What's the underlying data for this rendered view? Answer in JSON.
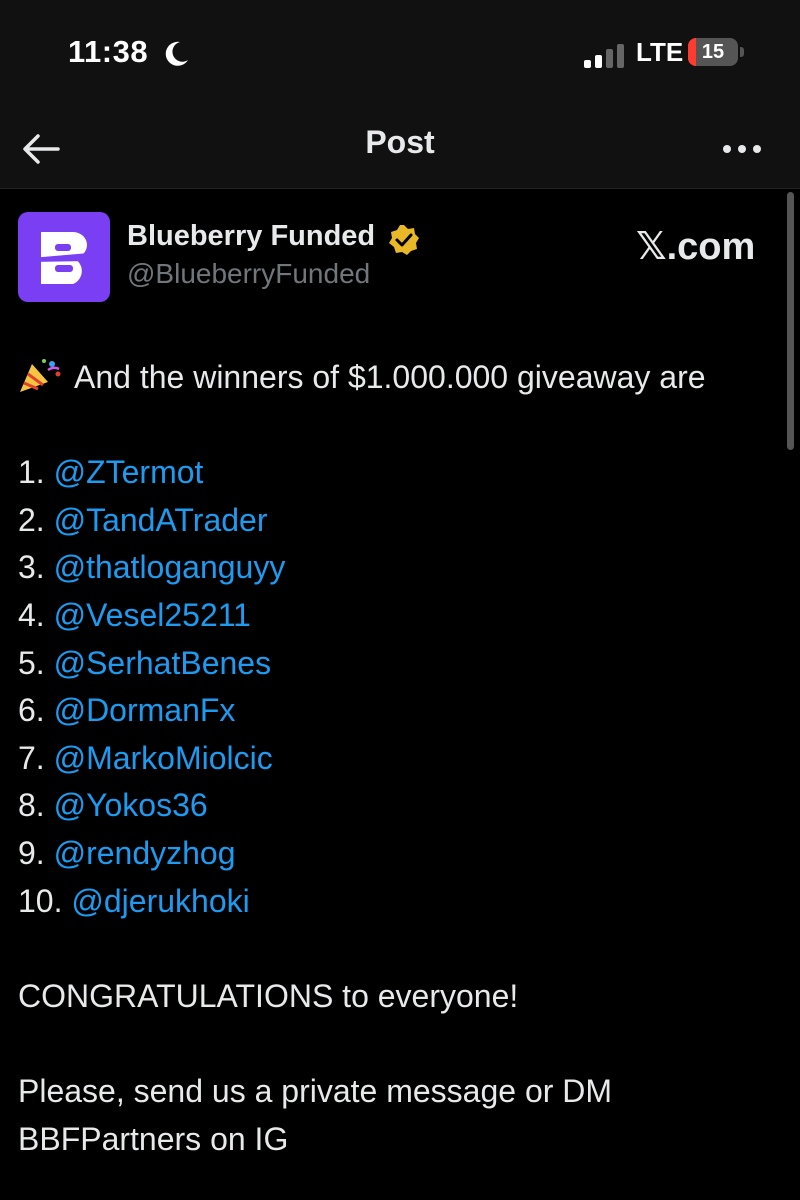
{
  "status": {
    "time": "11:38",
    "network": "LTE",
    "battery_level": "15",
    "battery_fraction": 0.15
  },
  "nav": {
    "title": "Post"
  },
  "author": {
    "avatar_letter": "B",
    "avatar_color": "#7a3ff2",
    "display_name": "Blueberry Funded",
    "handle": "@BlueberryFunded",
    "verified": true
  },
  "watermark": "𝕏.com",
  "post": {
    "intro": "And the winners of $1.000.000 giveaway are",
    "winners": [
      {
        "num": "1.",
        "handle": "@ZTermot"
      },
      {
        "num": "2.",
        "handle": "@TandATrader"
      },
      {
        "num": "3.",
        "handle": "@thatloganguyy"
      },
      {
        "num": "4.",
        "handle": "@Vesel25211"
      },
      {
        "num": "5.",
        "handle": "@SerhatBenes"
      },
      {
        "num": "6.",
        "handle": "@DormanFx"
      },
      {
        "num": "7.",
        "handle": "@MarkoMiolcic"
      },
      {
        "num": "8.",
        "handle": "@Yokos36"
      },
      {
        "num": "9.",
        "handle": "@rendyzhog"
      },
      {
        "num": "10.",
        "handle": "@djerukhoki"
      }
    ],
    "congrats": "CONGRATULATIONS to everyone!",
    "closing_line_1": "Please, send us a private message or DM",
    "closing_line_2": "BBFPartners on IG"
  },
  "colors": {
    "background": "#000000",
    "link": "#1d9bf0",
    "text": "#e7e9ea",
    "secondary": "#71767b",
    "verified_badge": "#e8b829"
  },
  "icons": [
    "moon-icon",
    "signal-icon",
    "battery-icon",
    "back-arrow-icon",
    "more-icon",
    "verified-badge-icon",
    "party-popper-icon"
  ]
}
